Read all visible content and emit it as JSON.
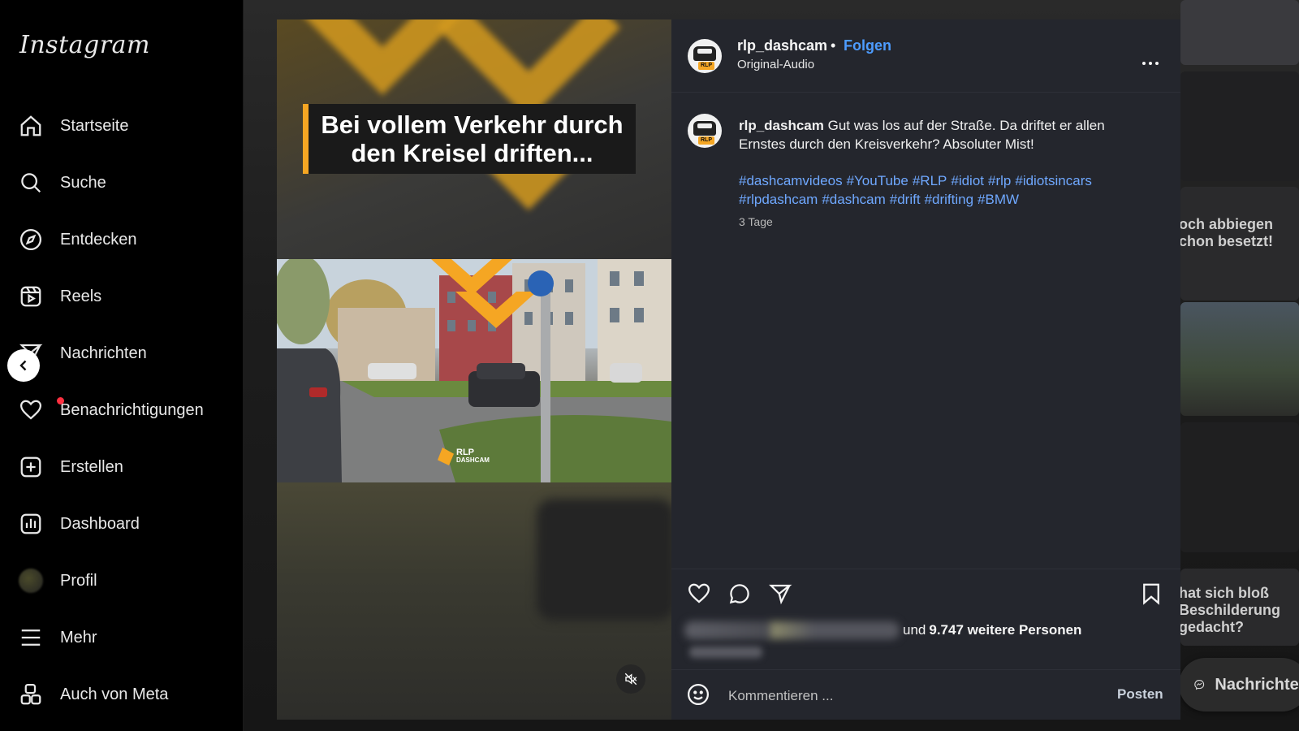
{
  "sidebar": {
    "logo": "Instagram",
    "items": [
      {
        "label": "Startseite",
        "icon": "home-icon"
      },
      {
        "label": "Suche",
        "icon": "search-icon"
      },
      {
        "label": "Entdecken",
        "icon": "compass-icon"
      },
      {
        "label": "Reels",
        "icon": "reels-icon"
      },
      {
        "label": "Nachrichten",
        "icon": "paper-plane-icon"
      },
      {
        "label": "Benachrichtigungen",
        "icon": "heart-icon"
      },
      {
        "label": "Erstellen",
        "icon": "plus-square-icon"
      },
      {
        "label": "Dashboard",
        "icon": "bar-chart-icon"
      },
      {
        "label": "Profil",
        "icon": "avatar"
      },
      {
        "label": "Mehr",
        "icon": "menu-icon"
      },
      {
        "label": "Auch von Meta",
        "icon": "meta-apps-icon"
      }
    ]
  },
  "video": {
    "caption": "Bei vollem Verkehr durch den Kreisel driften...",
    "watermark_line1": "RLP",
    "watermark_line2": "DASHCAM"
  },
  "post": {
    "username": "rlp_dashcam",
    "separator": "•",
    "follow_label": "Folgen",
    "audio": "Original-Audio",
    "caption_text": "Gut was los auf der Straße. Da driftet er allen Ernstes durch den Kreisverkehr? Absoluter Mist!",
    "hashtags": [
      "#dashcamvideos",
      "#YouTube",
      "#RLP",
      "#idiot",
      "#rlp",
      "#idiotsincars",
      "#rlpdashcam",
      "#dashcam",
      "#drift",
      "#drifting",
      "#BMW"
    ],
    "time_ago": "3 Tage",
    "likes_prefix": "und",
    "likes_text": "9.747 weitere Personen",
    "comment_placeholder": "Kommentieren ...",
    "post_label": "Posten"
  },
  "background": {
    "text_1_line1": "och abbiegen",
    "text_1_line2": "chon besetzt!",
    "text_2_line1": "hat sich bloß",
    "text_2_line2": "Beschilderung",
    "text_2_line3": "gedacht?",
    "messages_label": "Nachrichten"
  },
  "colors": {
    "panel_bg": "#24262d",
    "link_blue": "#4d9cff",
    "hashtag_blue": "#6fa8ff",
    "accent_orange": "#f5a623",
    "notification_red": "#ff3040"
  }
}
